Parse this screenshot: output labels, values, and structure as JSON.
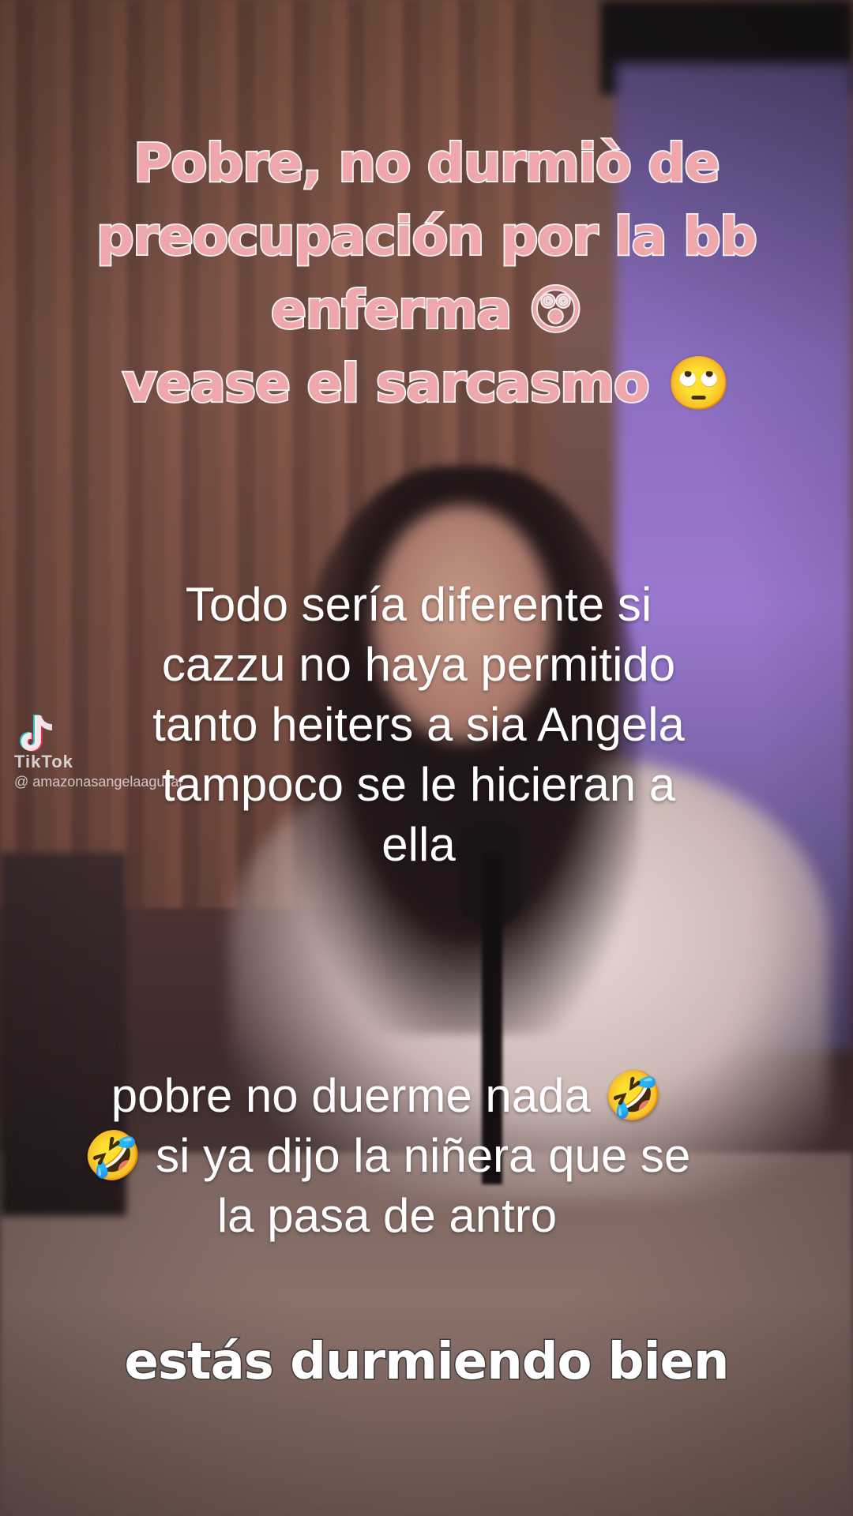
{
  "overlay_caption_pink": {
    "lines": [
      "Pobre, no durmiò de",
      "preocupación por la bb",
      "enferma 😲",
      "vease el sarcasmo 🙄"
    ]
  },
  "user_text_1": {
    "lines": [
      "Todo sería diferente si",
      "cazzu no haya permitido",
      "tanto heiters a sia Angela",
      "tampoco se le hicieran a",
      "ella"
    ]
  },
  "user_text_2": {
    "lines": [
      "pobre no duerme nada 🤣",
      "🤣 si ya dijo la niñera que se",
      "la pasa de antro"
    ]
  },
  "watermark": {
    "brand": "TikTok",
    "username": "@ amazonasangelaaguilar",
    "icon": "tiktok-logo-icon"
  },
  "video_subtitle": "estás durmiendo bien"
}
